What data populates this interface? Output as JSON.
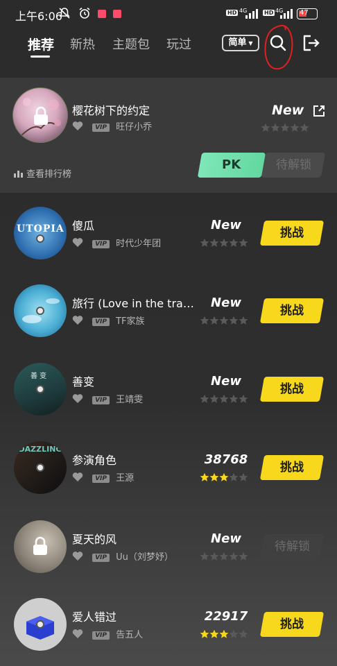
{
  "status_bar": {
    "time": "上午6:06",
    "network1": "4G",
    "network2": "4G",
    "hd": "HD",
    "battery": "47"
  },
  "tabs": [
    {
      "label": "推荐",
      "active": true
    },
    {
      "label": "新热",
      "active": false
    },
    {
      "label": "主题包",
      "active": false
    },
    {
      "label": "玩过",
      "active": false
    }
  ],
  "header": {
    "mode_label": "简单",
    "search_icon": "search-icon",
    "exit_icon": "exit-icon"
  },
  "featured": {
    "title": "樱花树下的约定",
    "vip_label": "VIP",
    "artist": "旺仔小乔",
    "score_label": "New",
    "rating": 0,
    "rank_link": "查看排行榜",
    "pk_label": "PK",
    "locked_label": "待解锁",
    "locked": true
  },
  "songs": [
    {
      "title": "傻瓜",
      "artist": "时代少年团",
      "score": "New",
      "rating": 0,
      "action": "挑战",
      "locked": false
    },
    {
      "title": "旅行 (Love in the tra…",
      "artist": "TF家族",
      "score": "New",
      "rating": 0,
      "action": "挑战",
      "locked": false
    },
    {
      "title": "善变",
      "artist": "王靖雯",
      "score": "New",
      "rating": 0,
      "action": "挑战",
      "locked": false
    },
    {
      "title": "参演角色",
      "artist": "王源",
      "score": "38768",
      "rating": 3,
      "action": "挑战",
      "locked": false
    },
    {
      "title": "夏天的风",
      "artist": "Uu（刘梦妤）",
      "score": "New",
      "rating": 0,
      "action": "待解锁",
      "locked": true
    },
    {
      "title": "爱人错过",
      "artist": "告五人",
      "score": "22917",
      "rating": 3,
      "action": "挑战",
      "locked": false
    }
  ],
  "vip_label": "VIP",
  "colors": {
    "accent_yellow": "#f7d81c",
    "pk_green": "#6fdcaa",
    "star_filled": "#f7d81c",
    "star_empty": "#5a5a5a",
    "annotation_red": "#e02020"
  }
}
